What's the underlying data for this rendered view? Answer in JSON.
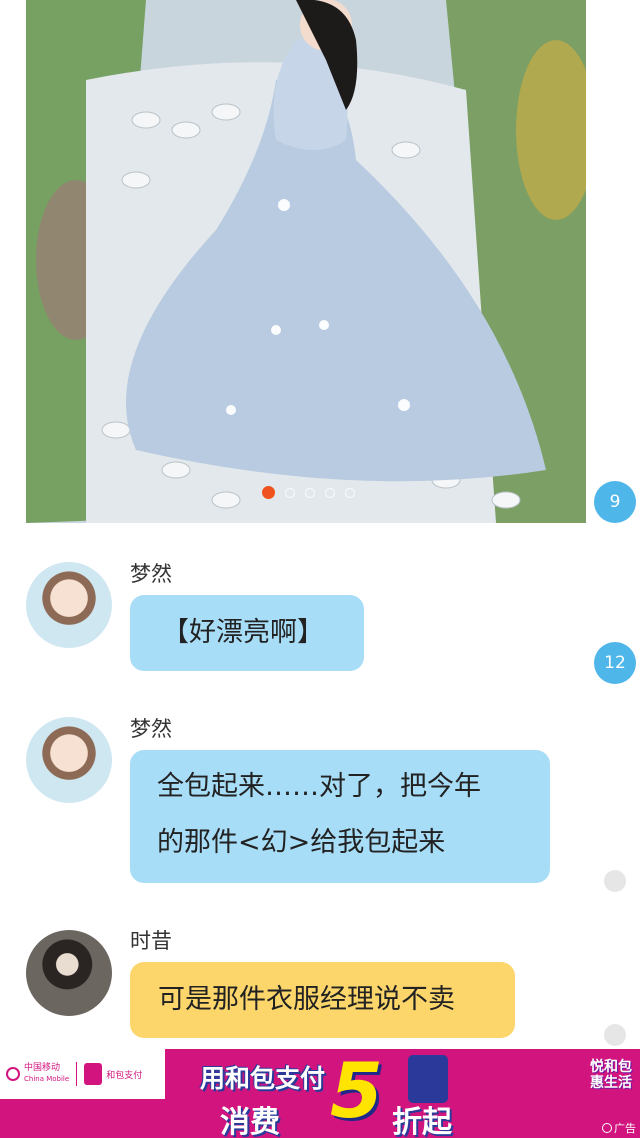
{
  "post_image": {
    "carousel_total": 5,
    "carousel_active": 1
  },
  "badges": {
    "first": "9",
    "second": "12"
  },
  "messages": [
    {
      "sender": "梦然",
      "text": "【好漂亮啊】"
    },
    {
      "sender": "梦然",
      "line1": "全包起来……对了，把今年",
      "line2": "的那件<幻>给我包起来"
    },
    {
      "sender": "时昔",
      "text": "可是那件衣服经理说不卖"
    }
  ],
  "ad": {
    "carrier": "中国移动",
    "carrier_en": "China Mobile",
    "wallet": "和包支付",
    "headline": "用和包支付",
    "big_number": "5",
    "line2a": "消费",
    "line2b": "折起",
    "slogan_line1": "悦和包",
    "slogan_line2": "惠生活",
    "tag": "广告",
    "brand_color": "#d2147f"
  },
  "colors": {
    "bubble_blue": "#a8ddf7",
    "bubble_yellow": "#fcd66b",
    "badge_blue": "#4fb6ea"
  }
}
